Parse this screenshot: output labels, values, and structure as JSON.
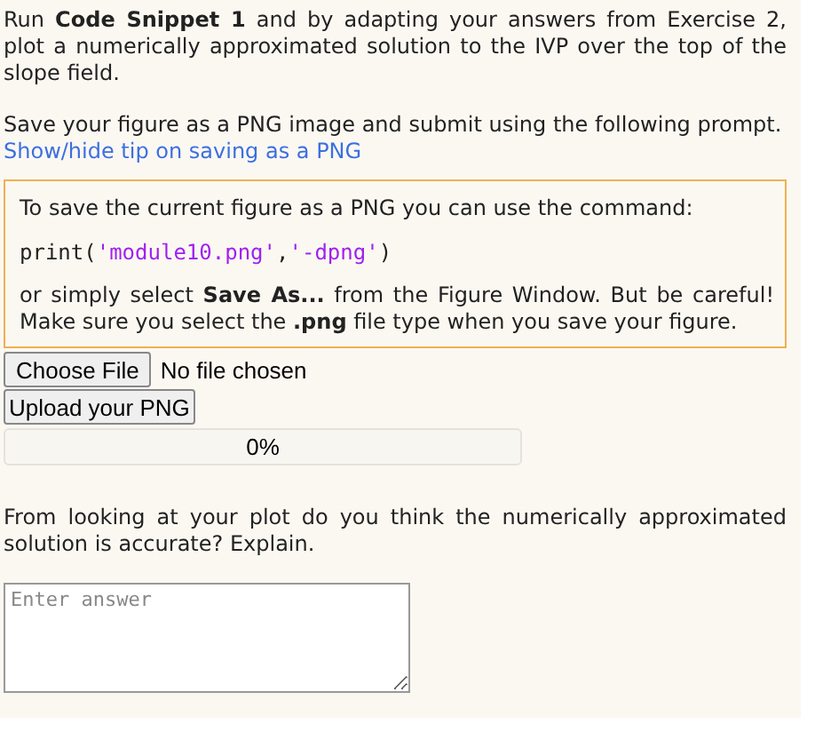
{
  "intro": "Run **Code Snippet 1** and by adapting your answers from Exercise 2, plot a numerically approximated solution to the IVP over the top of the slope field.",
  "save_prompt": "Save your figure as a PNG image and submit using the following prompt.",
  "tip_link": "Show/hide tip on saving as a PNG",
  "tip": {
    "lead": "To save the current figure as a PNG you can use the command:",
    "code": [
      {
        "kind": "plain",
        "text": "print("
      },
      {
        "kind": "string",
        "text": "'module10.png'"
      },
      {
        "kind": "plain",
        "text": ","
      },
      {
        "kind": "string",
        "text": "'-dpng'"
      },
      {
        "kind": "plain",
        "text": ")"
      }
    ],
    "note": "or simply select **Save As...** from the Figure Window. But be careful! Make sure you select the **.png** file type when you save your figure."
  },
  "file_input": {
    "button": "Choose File",
    "status": "No file chosen"
  },
  "upload_button": "Upload your PNG",
  "progress": {
    "level": 0,
    "reading": "0%"
  },
  "question": "From looking at your plot do you think the numerically approximated solution is accurate? Explain.",
  "answer": {
    "placeholder": "Enter answer"
  }
}
